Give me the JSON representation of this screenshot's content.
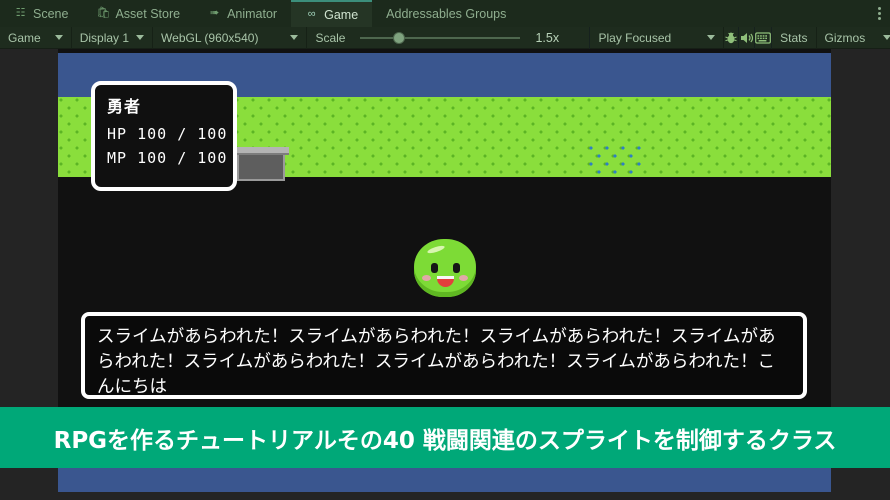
{
  "tabs": [
    {
      "label": "Scene",
      "icon": "grid-icon",
      "icon_glyph": "⌗",
      "active": false
    },
    {
      "label": "Asset Store",
      "icon": "shopping-bag-icon",
      "icon_glyph": "⛃",
      "active": false
    },
    {
      "label": "Animator",
      "icon": "animator-icon",
      "icon_glyph": "➤",
      "active": false
    },
    {
      "label": "Game",
      "icon": "gamepad-icon",
      "icon_glyph": "∞",
      "active": true
    },
    {
      "label": "Addressables Groups",
      "icon": "none",
      "icon_glyph": "",
      "active": false
    }
  ],
  "toolbar": {
    "aspect_label": "Game",
    "display_label": "Display 1",
    "resolution_label": "WebGL (960x540)",
    "scale_label": "Scale",
    "scale_value": "1.5x",
    "play_mode_label": "Play Focused",
    "stats_label": "Stats",
    "gizmos_label": "Gizmos",
    "mute_icon": "speaker-icon",
    "bug_icon": "bug-icon",
    "keyboard_icon": "keyboard-icon"
  },
  "game": {
    "status_window": {
      "name": "勇者",
      "hp_line": "HP 100 / 100",
      "mp_line": "MP 100 / 100"
    },
    "dialogue_text": "スライムがあらわれた！スライムがあらわれた！スライムがあらわれた！スライムがあらわれた！スライムがあらわれた！スライムがあらわれた！スライムがあらわれた！こんにちは",
    "enemy_name": "slime-sprite"
  },
  "banner": {
    "text": "RPGを作るチュートリアルその40 戦闘関連のスプライトを制御するクラス",
    "color": "#00a878"
  },
  "colors": {
    "tabbar_bg": "#1c2a1c",
    "active_tab_bg": "#253525",
    "toolbar_bg": "#1e2c1e",
    "sky": "#3a568f",
    "grass": "#8ade3c",
    "accent": "#00a878"
  }
}
